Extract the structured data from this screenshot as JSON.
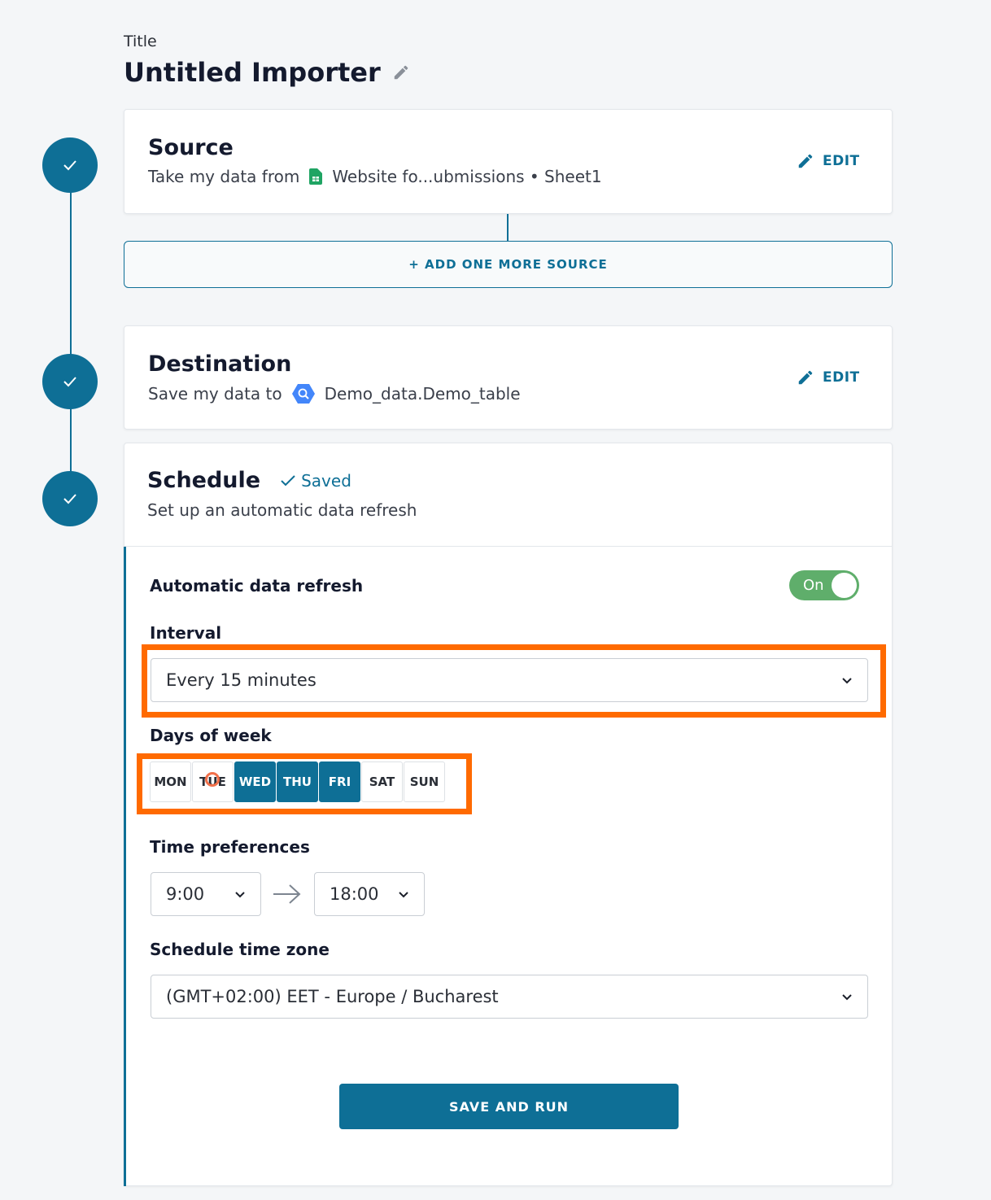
{
  "header": {
    "label": "Title",
    "title": "Untitled Importer"
  },
  "source": {
    "title": "Source",
    "prefix": "Take my data from",
    "file": "Website fo...ubmissions • Sheet1",
    "edit_label": "EDIT"
  },
  "add_source_label": "+ ADD ONE MORE SOURCE",
  "destination": {
    "title": "Destination",
    "prefix": "Save my data to",
    "table": "Demo_data.Demo_table",
    "edit_label": "EDIT"
  },
  "schedule": {
    "title": "Schedule",
    "saved_label": "Saved",
    "subtitle": "Set up an automatic data refresh",
    "auto_refresh_label": "Automatic data refresh",
    "toggle_label": "On",
    "interval_label": "Interval",
    "interval_value": "Every 15 minutes",
    "days_label": "Days of week",
    "days": [
      {
        "label": "MON",
        "selected": false
      },
      {
        "label": "TUE",
        "selected": false
      },
      {
        "label": "WED",
        "selected": true
      },
      {
        "label": "THU",
        "selected": true
      },
      {
        "label": "FRI",
        "selected": true
      },
      {
        "label": "SAT",
        "selected": false
      },
      {
        "label": "SUN",
        "selected": false
      }
    ],
    "time_label": "Time preferences",
    "time_from": "9:00",
    "time_to": "18:00",
    "timezone_label": "Schedule time zone",
    "timezone_value": "(GMT+02:00) EET - Europe / Bucharest",
    "save_run_label": "SAVE AND RUN"
  },
  "colors": {
    "primary": "#0e6f96",
    "toggle_on": "#5fae6b",
    "highlight": "#ff6a00",
    "sheets_green": "#1fa463",
    "bigquery_blue": "#4386fa"
  }
}
